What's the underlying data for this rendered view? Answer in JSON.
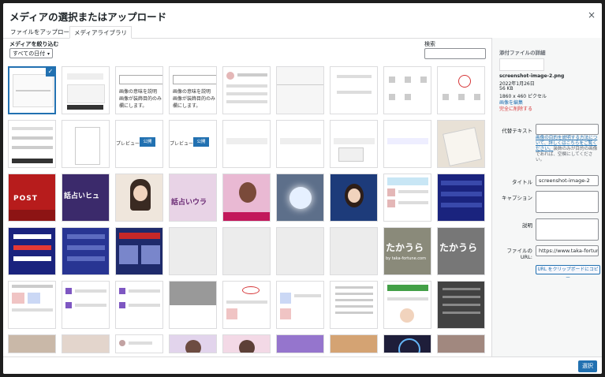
{
  "modal": {
    "title": "メディアの選択またはアップロード",
    "close_label": "×"
  },
  "tabs": [
    {
      "label": "ファイルをアップロード"
    },
    {
      "label": "メディアライブラリ"
    }
  ],
  "filter": {
    "label": "メディアを絞り込む",
    "date_value": "すべての日付"
  },
  "search": {
    "label": "検索",
    "value": ""
  },
  "sidebar": {
    "heading": "添付ファイルの詳細",
    "filename": "screenshot-image-2.png",
    "date": "2022年1月26日",
    "filesize": "56 KB",
    "dimensions": "1860 x 460 ピクセル",
    "edit_link": "画像を編集",
    "delete_link": "完全に削除する",
    "alt_label": "代替テキスト",
    "alt_value": "",
    "alt_desc_link": "画像の目的を説明する方法について、詳しくはこちらをご覧ください。",
    "alt_desc_rest": "装飾のみが目的の画像であれば、空欄にしてください。",
    "title_label": "タイトル",
    "title_value": "screenshot-image-2",
    "caption_label": "キャプション",
    "caption_value": "",
    "desc_label": "説明",
    "desc_value": "",
    "url_label": "ファイルの URL:",
    "url_value": "https://www.taka-fortune.",
    "copy_button": "URL をクリップボードにコピー"
  },
  "footer": {
    "select_button": "選択"
  },
  "thumb_text": {
    "post": "POST",
    "takaura1": "たかうら",
    "takaura2": "たかうら",
    "takaura_sub": "by taka-fortune.com",
    "preview1": "プレビュー",
    "public1": "公開",
    "preview2": "プレビュー",
    "public2": "公開",
    "text1": "画像の意味を説明",
    "text1b": "画像が装飾目的のみ",
    "text1c": "欄にします。",
    "text2": "画像の意味を説明",
    "text2b": "画像が装飾目的のみ",
    "text2c": "欄にします。",
    "banner1": "話占いヒュ",
    "banner2": "話占いウラ"
  },
  "colors": {
    "accent": "#2271b1",
    "danger": "#d63638"
  }
}
